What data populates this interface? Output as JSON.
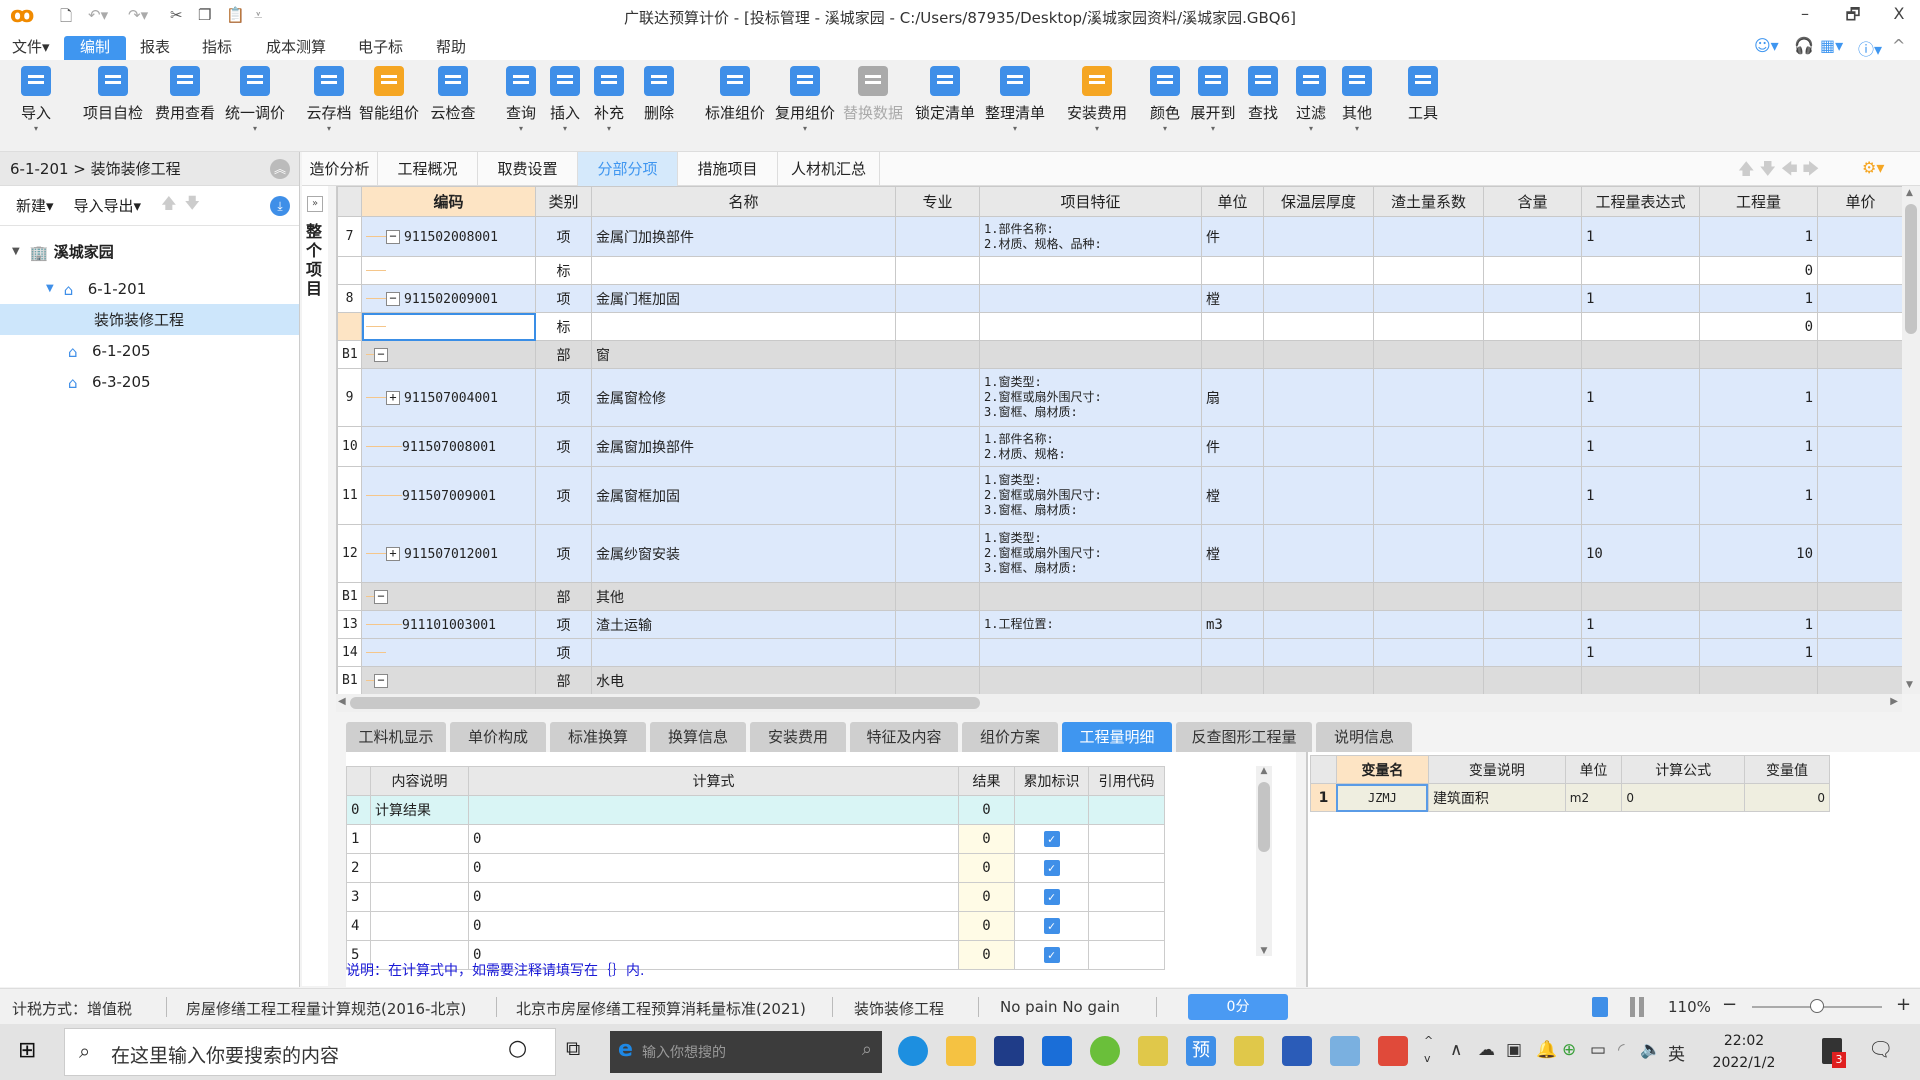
{
  "window": {
    "title": "广联达预算计价 - [投标管理 - 溪城家园 - C:/Users/87935/Desktop/溪城家园资料/溪城家园.GBQ6]",
    "controls": {
      "minimize": "–",
      "restore": "🗗",
      "close": "X"
    }
  },
  "menu": [
    "文件▾",
    "编制",
    "报表",
    "指标",
    "成本测算",
    "电子标",
    "帮助"
  ],
  "menu_active": "编制",
  "toolbar": [
    {
      "label": "导入",
      "icon": "import-icon",
      "dropdown": true
    },
    {
      "label": "项目自检",
      "icon": "self-check-icon"
    },
    {
      "label": "费用查看",
      "icon": "fee-view-icon"
    },
    {
      "label": "统一调价",
      "icon": "adjust-price-icon",
      "dropdown": true
    },
    {
      "label": "云存档",
      "icon": "cloud-save-icon",
      "dropdown": true
    },
    {
      "label": "智能组价",
      "icon": "smart-price-icon"
    },
    {
      "label": "云检查",
      "icon": "cloud-check-icon"
    },
    {
      "label": "查询",
      "icon": "query-icon",
      "dropdown": true
    },
    {
      "label": "插入",
      "icon": "insert-icon",
      "dropdown": true
    },
    {
      "label": "补充",
      "icon": "supplement-icon",
      "dropdown": true
    },
    {
      "label": "删除",
      "icon": "delete-icon"
    },
    {
      "label": "标准组价",
      "icon": "standard-price-icon"
    },
    {
      "label": "复用组价",
      "icon": "reuse-price-icon",
      "dropdown": true
    },
    {
      "label": "替换数据",
      "icon": "replace-data-icon",
      "disabled": true
    },
    {
      "label": "锁定清单",
      "icon": "lock-list-icon"
    },
    {
      "label": "整理清单",
      "icon": "organize-list-icon",
      "dropdown": true
    },
    {
      "label": "安装费用",
      "icon": "install-fee-icon",
      "dropdown": true
    },
    {
      "label": "颜色",
      "icon": "color-icon",
      "dropdown": true
    },
    {
      "label": "展开到",
      "icon": "expand-to-icon",
      "dropdown": true
    },
    {
      "label": "查找",
      "icon": "find-icon"
    },
    {
      "label": "过滤",
      "icon": "filter-icon",
      "dropdown": true
    },
    {
      "label": "其他",
      "icon": "other-icon",
      "dropdown": true
    },
    {
      "label": "工具",
      "icon": "tools-icon"
    }
  ],
  "left_panel": {
    "breadcrumb": "6-1-201 > 装饰装修工程",
    "new_label": "新建▾",
    "import_export_label": "导入导出▾",
    "tree": [
      {
        "label": "溪城家园",
        "level": 0,
        "icon": "building-icon",
        "expanded": true
      },
      {
        "label": "6-1-201",
        "level": 1,
        "icon": "house-icon",
        "expanded": true
      },
      {
        "label": "装饰装修工程",
        "level": 2,
        "selected": true
      },
      {
        "label": "6-1-205",
        "level": 1,
        "icon": "house-icon"
      },
      {
        "label": "6-3-205",
        "level": 1,
        "icon": "house-icon"
      }
    ]
  },
  "strip_label": "整个项目",
  "main_tabs": [
    "造价分析",
    "工程概况",
    "取费设置",
    "分部分项",
    "措施项目",
    "人材机汇总"
  ],
  "main_tab_active": "分部分项",
  "grid": {
    "columns": [
      "",
      "编码",
      "类别",
      "名称",
      "专业",
      "项目特征",
      "单位",
      "保温层厚度",
      "渣土量系数",
      "含量",
      "工程量表达式",
      "工程量",
      "单价"
    ],
    "rows": [
      {
        "no": "7",
        "type": "xiang",
        "box": "−",
        "code": "911502008001",
        "cat": "项",
        "name": "金属门加换部件",
        "feat": "1.部件名称:\n2.材质、规格、品种:",
        "unit": "件",
        "expr": "1",
        "qty": "1"
      },
      {
        "no": "",
        "type": "biao",
        "box": "",
        "code": "",
        "cat": "标",
        "name": "",
        "feat": "",
        "unit": "",
        "expr": "",
        "qty": "0"
      },
      {
        "no": "8",
        "type": "xiang",
        "box": "−",
        "code": "911502009001",
        "cat": "项",
        "name": "金属门框加固",
        "feat": "",
        "unit": "樘",
        "expr": "1",
        "qty": "1"
      },
      {
        "no": "",
        "type": "biao",
        "box": "",
        "code": "",
        "cat": "标",
        "name": "",
        "feat": "",
        "unit": "",
        "expr": "",
        "qty": "0",
        "current": true
      },
      {
        "no": "B1",
        "type": "bu",
        "box": "−",
        "code": "",
        "cat": "部",
        "name": "窗",
        "feat": "",
        "unit": "",
        "expr": "",
        "qty": ""
      },
      {
        "no": "9",
        "type": "xiang",
        "box": "+",
        "code": "911507004001",
        "cat": "项",
        "name": "金属窗检修",
        "feat": "1.窗类型:\n2.窗框或扇外围尺寸:\n3.窗框、扇材质:",
        "unit": "扇",
        "expr": "1",
        "qty": "1"
      },
      {
        "no": "10",
        "type": "xiang",
        "box": "",
        "code": "911507008001",
        "cat": "项",
        "name": "金属窗加换部件",
        "feat": "1.部件名称:\n2.材质、规格:",
        "unit": "件",
        "expr": "1",
        "qty": "1"
      },
      {
        "no": "11",
        "type": "xiang",
        "box": "",
        "code": "911507009001",
        "cat": "项",
        "name": "金属窗框加固",
        "feat": "1.窗类型:\n2.窗框或扇外围尺寸:\n3.窗框、扇材质:",
        "unit": "樘",
        "expr": "1",
        "qty": "1"
      },
      {
        "no": "12",
        "type": "xiang",
        "box": "+",
        "code": "911507012001",
        "cat": "项",
        "name": "金属纱窗安装",
        "feat": "1.窗类型:\n2.窗框或扇外围尺寸:\n3.窗框、扇材质:",
        "unit": "樘",
        "expr": "10",
        "qty": "10"
      },
      {
        "no": "B1",
        "type": "bu",
        "box": "−",
        "code": "",
        "cat": "部",
        "name": "其他",
        "feat": "",
        "unit": "",
        "expr": "",
        "qty": ""
      },
      {
        "no": "13",
        "type": "xiang",
        "box": "",
        "code": "911101003001",
        "cat": "项",
        "name": "渣土运输",
        "feat": "1.工程位置:",
        "unit": "m3",
        "expr": "1",
        "qty": "1"
      },
      {
        "no": "14",
        "type": "xiang",
        "box": "",
        "code": "",
        "cat": "项",
        "name": "",
        "feat": "",
        "unit": "",
        "expr": "1",
        "qty": "1"
      },
      {
        "no": "B1",
        "type": "bu",
        "box": "−",
        "code": "",
        "cat": "部",
        "name": "水电",
        "feat": "",
        "unit": "",
        "expr": "",
        "qty": ""
      }
    ]
  },
  "bottom_tabs": [
    "工料机显示",
    "单价构成",
    "标准换算",
    "换算信息",
    "安装费用",
    "特征及内容",
    "组价方案",
    "工程量明细",
    "反查图形工程量",
    "说明信息"
  ],
  "bottom_tab_active": "工程量明细",
  "qty_detail": {
    "columns": [
      "",
      "内容说明",
      "计算式",
      "结果",
      "累加标识",
      "引用代码"
    ],
    "rows": [
      {
        "no": "0",
        "desc": "计算结果",
        "formula": "",
        "result": "0",
        "checked": false
      },
      {
        "no": "1",
        "desc": "",
        "formula": "0",
        "result": "0",
        "checked": true
      },
      {
        "no": "2",
        "desc": "",
        "formula": "0",
        "result": "0",
        "checked": true
      },
      {
        "no": "3",
        "desc": "",
        "formula": "0",
        "result": "0",
        "checked": true
      },
      {
        "no": "4",
        "desc": "",
        "formula": "0",
        "result": "0",
        "checked": true
      },
      {
        "no": "5",
        "desc": "",
        "formula": "0",
        "result": "0",
        "checked": true
      }
    ],
    "note": "说明：在计算式中，如需要注释请填写在｛｝内."
  },
  "variables": {
    "columns": [
      "",
      "变量名",
      "变量说明",
      "单位",
      "计算公式",
      "变量值"
    ],
    "rows": [
      {
        "no": "1",
        "name": "JZMJ",
        "desc": "建筑面积",
        "unit": "m2",
        "formula": "0",
        "value": "0"
      }
    ]
  },
  "statusbar": {
    "tax": "计税方式：增值税",
    "spec": "房屋修缮工程工程量计算规范(2016-北京)",
    "standard": "北京市房屋修缮工程预算消耗量标准(2021)",
    "project": "装饰装修工程",
    "motto": "No pain No gain",
    "score": "0分",
    "zoom": "110%",
    "zoom_level_pct": 110
  },
  "taskbar": {
    "search_placeholder": "在这里输入你要搜索的内容",
    "browser_search_placeholder": "输入你想搜的",
    "tray_lang": "英",
    "time": "22:02",
    "date": "2022/1/2",
    "notification_count": "3"
  }
}
